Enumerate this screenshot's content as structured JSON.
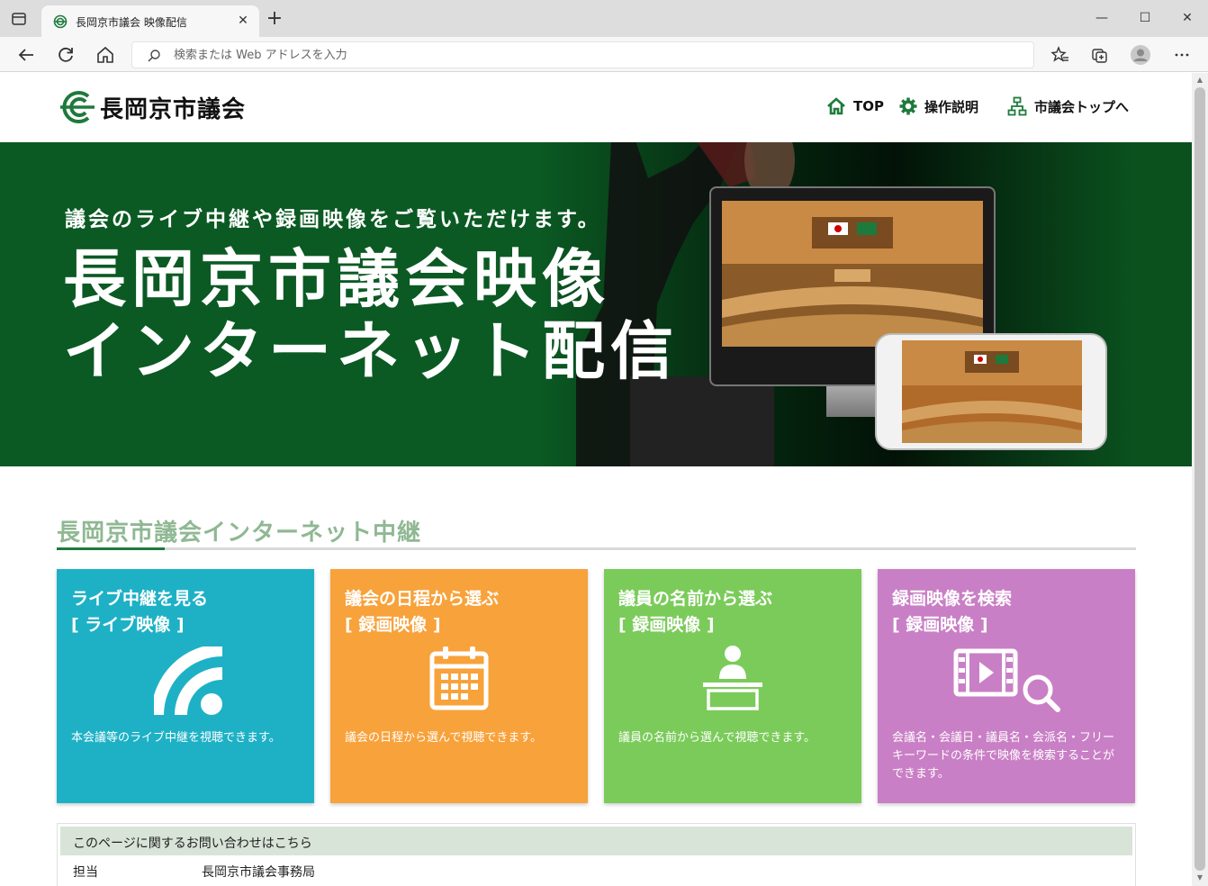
{
  "browser": {
    "tab_title": "長岡京市議会 映像配信",
    "address_placeholder": "検索または Web アドレスを入力",
    "close_tab": "✕",
    "new_tab": "+",
    "minimize": "—",
    "maximize": "☐",
    "close_window": "✕"
  },
  "site": {
    "logo_text": "長岡京市議会",
    "nav": [
      {
        "label": "TOP",
        "icon": "home-icon"
      },
      {
        "label": "操作説明",
        "icon": "gear-icon"
      },
      {
        "label": "市議会トップへ",
        "icon": "sitemap-icon"
      }
    ]
  },
  "hero": {
    "subtitle": "議会のライブ中継や録画映像をご覧いただけます。",
    "title_line1": "長岡京市議会映像",
    "title_line2": "インターネット配信"
  },
  "section": {
    "title": "長岡京市議会インターネット中継"
  },
  "cards": [
    {
      "title": "ライブ中継を見る",
      "sub": "[ ライブ映像 ]",
      "desc": "本会議等のライブ中継を視聴できます。",
      "color": "#1eb1c6",
      "icon": "broadcast-icon"
    },
    {
      "title": "議会の日程から選ぶ",
      "sub": "[ 録画映像 ]",
      "desc": "議会の日程から選んで視聴できます。",
      "color": "#f8a23b",
      "icon": "calendar-icon"
    },
    {
      "title": "議員の名前から選ぶ",
      "sub": "[ 録画映像 ]",
      "desc": "議員の名前から選んで視聴できます。",
      "color": "#7bcb5a",
      "icon": "speaker-podium-icon"
    },
    {
      "title": "録画映像を検索",
      "sub": "[ 録画映像 ]",
      "desc": "会議名・会議日・議員名・会派名・フリーキーワードの条件で映像を検索することができます。",
      "color": "#c97fc5",
      "icon": "video-search-icon"
    }
  ],
  "contact": {
    "heading": "このページに関するお問い合わせはこちら",
    "label": "担当",
    "value": "長岡京市議会事務局"
  },
  "colors": {
    "hero_green": "#0b5a23",
    "accent_green": "#1e7a3c",
    "section_title": "#8fb893"
  }
}
